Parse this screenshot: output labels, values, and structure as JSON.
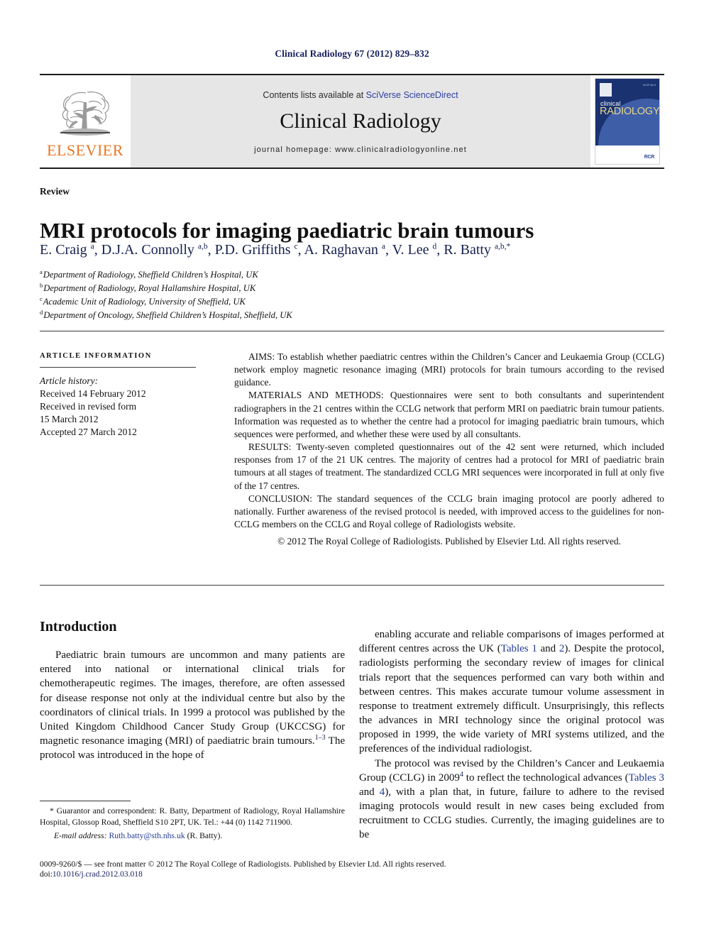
{
  "running_head": "Clinical Radiology 67 (2012) 829–832",
  "masthead": {
    "publisher_wordmark": "ELSEVIER",
    "contents_prefix": "Contents lists available at ",
    "contents_link": "SciVerse ScienceDirect",
    "journal_title": "Clinical Radiology",
    "homepage": "journal homepage: www.clinicalradiologyonline.net",
    "cover": {
      "word_top": "clinical",
      "word_main": "RADIOLOGY",
      "badge": "RCR",
      "issue_note": "Vol 67 No 9"
    }
  },
  "article": {
    "section_label": "Review",
    "title": "MRI protocols for imaging paediatric brain tumours",
    "authors_html": "E. Craig <sup>a</sup>, D.J.A. Connolly <sup>a,b</sup>, P.D. Griffiths <sup>c</sup>, A. Raghavan <sup>a</sup>, V. Lee <sup>d</sup>, R. Batty <sup>a,b,</sup><sup>*</sup>",
    "affiliations": [
      {
        "marker": "a",
        "text": "Department of Radiology, Sheffield Children’s Hospital, UK"
      },
      {
        "marker": "b",
        "text": "Department of Radiology, Royal Hallamshire Hospital, UK"
      },
      {
        "marker": "c",
        "text": "Academic Unit of Radiology, University of Sheffield, UK"
      },
      {
        "marker": "d",
        "text": "Department of Oncology, Sheffield Children’s Hospital, Sheffield, UK"
      }
    ]
  },
  "article_info": {
    "heading": "ARTICLE INFORMATION",
    "history_label": "Article history:",
    "history": [
      "Received 14 February 2012",
      "Received in revised form",
      "15 March 2012",
      "Accepted 27 March 2012"
    ]
  },
  "abstract": {
    "aims": "AIMS: To establish whether paediatric centres within the Children’s Cancer and Leukaemia Group (CCLG) network employ magnetic resonance imaging (MRI) protocols for brain tumours according to the revised guidance.",
    "materials": "MATERIALS AND METHODS: Questionnaires were sent to both consultants and superintendent radiographers in the 21 centres within the CCLG network that perform MRI on paediatric brain tumour patients. Information was requested as to whether the centre had a protocol for imaging paediatric brain tumours, which sequences were performed, and whether these were used by all consultants.",
    "results": "RESULTS: Twenty-seven completed questionnaires out of the 42 sent were returned, which included responses from 17 of the 21 UK centres. The majority of centres had a protocol for MRI of paediatric brain tumours at all stages of treatment. The standardized CCLG MRI sequences were incorporated in full at only five of the 17 centres.",
    "conclusion": "CONCLUSION: The standard sequences of the CCLG brain imaging protocol are poorly adhered to nationally. Further awareness of the revised protocol is needed, with improved access to the guidelines for non-CCLG members on the CCLG and Royal college of Radiologists website.",
    "copyright": "© 2012 The Royal College of Radiologists. Published by Elsevier Ltd. All rights reserved."
  },
  "body": {
    "introduction_heading": "Introduction",
    "left_paragraph_html": "Paediatric brain tumours are uncommon and many patients are entered into national or international clinical trials for chemotherapeutic regimes. The images, therefore, are often assessed for disease response not only at the individual centre but also by the coordinators of clinical trials. In 1999 a protocol was published by the United Kingdom Childhood Cancer Study Group (UKCCSG) for magnetic resonance imaging (MRI) of paediatric brain tumours.<sup>1&#8211;3</sup> The protocol was introduced in the hope of",
    "right_paragraph_1_html": "enabling accurate and reliable comparisons of images performed at different centres across the UK (<span class=\"xref\">Tables 1</span> and <span class=\"xref\">2</span>). Despite the protocol, radiologists performing the secondary review of images for clinical trials report that the sequences performed can vary both within and between centres. This makes accurate tumour volume assessment in response to treatment extremely difficult. Unsurprisingly, this reflects the advances in MRI technology since the original protocol was proposed in 1999, the wide variety of MRI systems utilized, and the preferences of the individual radiologist.",
    "right_paragraph_2_html": "The protocol was revised by the Children’s Cancer and Leukaemia Group (CCLG) in 2009<sup>4</sup> to reflect the technological advances (<span class=\"xref\">Tables 3</span> and <span class=\"xref\">4</span>), with a plan that, in future, failure to adhere to the revised imaging protocols would result in new cases being excluded from recruitment to CCLG studies. Currently, the imaging guidelines are to be"
  },
  "footnote": {
    "correspondence_html": "* Guarantor and correspondent: R. Batty, Department of Radiology, Royal Hallamshire Hospital, Glossop Road, Sheffield S10 2PT, UK. Tel.: +44 (0) 1142 711900.",
    "email_label": "E-mail address:",
    "email": "Ruth.batty@sth.nhs.uk",
    "email_suffix": "(R. Batty)."
  },
  "footer": {
    "issn_line": "0009-9260/$ — see front matter © 2012 The Royal College of Radiologists. Published by Elsevier Ltd. All rights reserved.",
    "doi_label": "doi:",
    "doi_value": "10.1016/j.crad.2012.03.018"
  },
  "colors": {
    "running_head": "#16205e",
    "link_blue": "#2b3f9e",
    "author_navy": "#15204f",
    "elsevier_orange": "#e87722",
    "cover_navy": "#1b3271",
    "masthead_grey": "#e6e6e6"
  }
}
